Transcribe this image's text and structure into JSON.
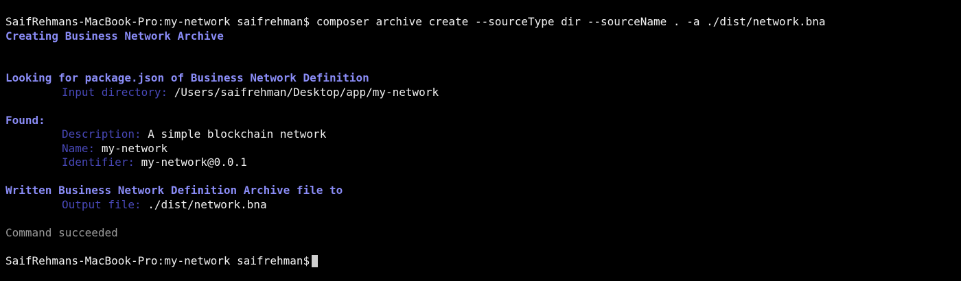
{
  "colors": {
    "background": "#000000",
    "text": "#f0f0f0",
    "heading": "#8a8cf6",
    "label": "#4848b8",
    "muted": "#9a9a9a",
    "cursor": "#cfcfcf"
  },
  "terminal": {
    "prompt": "SaifRehmans-MacBook-Pro:my-network saifrehman$",
    "command": "composer archive create --sourceType dir --sourceName . -a ./dist/network.bna",
    "creating": "Creating Business Network Archive",
    "looking_heading": "Looking for package.json of Business Network Definition",
    "input_dir_label": "Input directory:",
    "input_dir_value": "/Users/saifrehman/Desktop/app/my-network",
    "found_heading": "Found:",
    "description_label": "Description:",
    "description_value": "A simple blockchain network",
    "name_label": "Name:",
    "name_value": "my-network",
    "identifier_label": "Identifier:",
    "identifier_value": "my-network@0.0.1",
    "written_heading": "Written Business Network Definition Archive file to",
    "output_file_label": "Output file:",
    "output_file_value": "./dist/network.bna",
    "success": "Command succeeded",
    "final_prompt": "SaifRehmans-MacBook-Pro:my-network saifrehman$"
  }
}
